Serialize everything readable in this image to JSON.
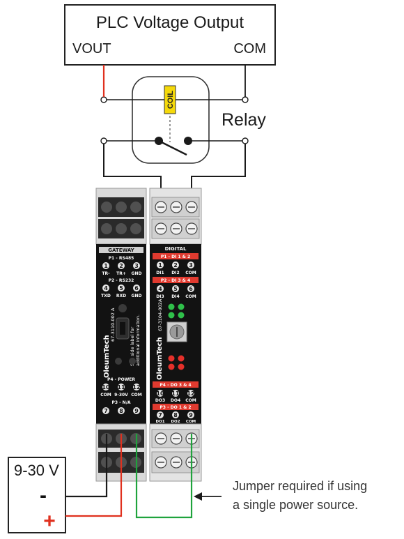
{
  "plc": {
    "title": "PLC Voltage Output",
    "vout_label": "VOUT",
    "com_label": "COM"
  },
  "relay": {
    "label": "Relay",
    "coil_label": "COIL"
  },
  "power_supply": {
    "label": "9-30 V",
    "minus": "-",
    "plus": "+"
  },
  "note": {
    "line1": "Jumper required if using",
    "line2": "a single power source."
  },
  "gateway_module": {
    "title": "GATEWAY",
    "p1_header": "P1 - RS485",
    "p1_nums": [
      "1",
      "2",
      "3"
    ],
    "p1_labels": [
      "TR-",
      "TR+",
      "GND"
    ],
    "p2_header": "P2 - RS232",
    "p2_nums": [
      "4",
      "5",
      "6"
    ],
    "p2_labels": [
      "TXD",
      "RXD",
      "GND"
    ],
    "brand": "OleumTech",
    "part_no": "67-3110-002 A",
    "side_text_1": "See side label for",
    "side_text_2": "additional information.",
    "p4_header": "P4 - POWER",
    "p4_nums": [
      "10",
      "11",
      "12"
    ],
    "p4_labels": [
      "COM",
      "9-30V",
      "COM"
    ],
    "p3_header": "P3 - N/A",
    "p3_nums": [
      "7",
      "8",
      "9"
    ]
  },
  "digital_module": {
    "title": "DIGITAL",
    "p1_header": "P1 - DI 1 & 2",
    "p1_nums": [
      "1",
      "2",
      "3"
    ],
    "p1_labels": [
      "DI1",
      "DI2",
      "COM"
    ],
    "p2_header": "P2 - DI 3 & 4",
    "p2_nums": [
      "4",
      "5",
      "6"
    ],
    "p2_labels": [
      "DI3",
      "DI4",
      "COM"
    ],
    "brand": "OleumTech",
    "part_no": "67-3104-002A",
    "p4_header": "P4 - DO 3 & 4",
    "p4_nums": [
      "10",
      "11",
      "12"
    ],
    "p4_labels": [
      "DO3",
      "DO4",
      "COM"
    ],
    "p3_header": "P3 - DO 1 & 2",
    "p3_nums": [
      "7",
      "8",
      "9"
    ],
    "p3_labels": [
      "DO1",
      "DO2",
      "COM"
    ]
  },
  "colors": {
    "wire_black": "#1a1a1a",
    "wire_red": "#e0301e",
    "wire_green": "#1fa33c",
    "coil_yellow": "#f5d90a",
    "module_red": "#e03a2f"
  }
}
